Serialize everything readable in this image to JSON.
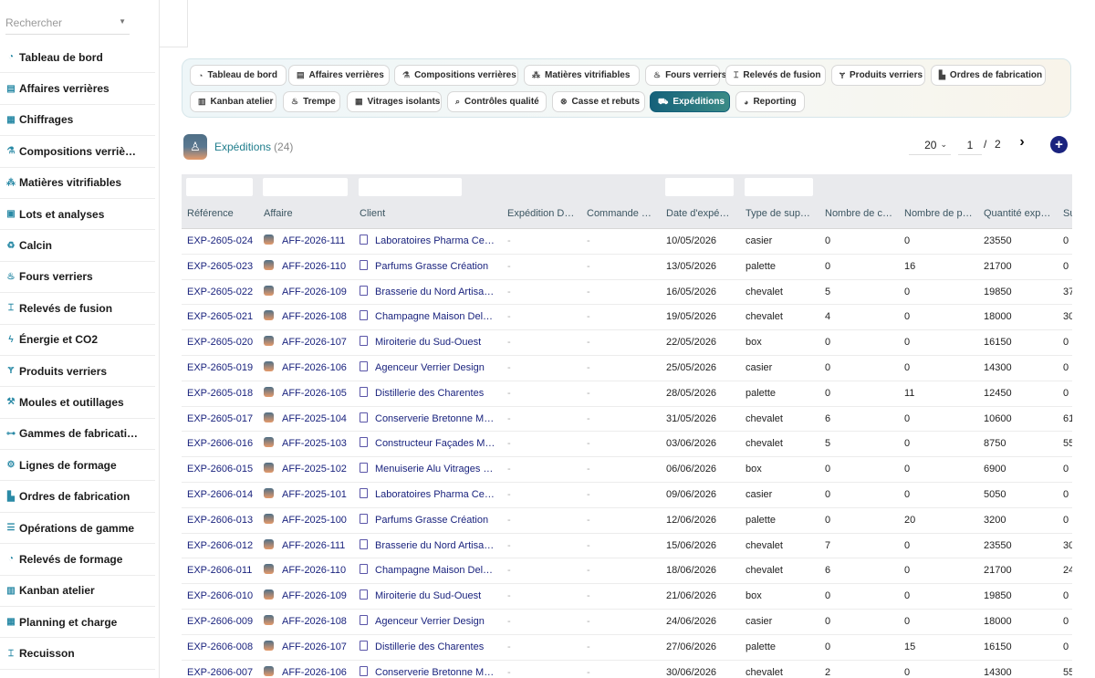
{
  "sidebar": {
    "search_placeholder": "Rechercher",
    "items": [
      {
        "label": "Tableau de bord",
        "icon": "gauge-icon",
        "glyph": "◔"
      },
      {
        "label": "Affaires verrières",
        "icon": "briefcase-icon",
        "glyph": "▤"
      },
      {
        "label": "Chiffrages",
        "icon": "calculator-icon",
        "glyph": "▦"
      },
      {
        "label": "Compositions verriè…",
        "icon": "flask-icon",
        "glyph": "⚗"
      },
      {
        "label": "Matières vitrifiables",
        "icon": "cubes-icon",
        "glyph": "⁂"
      },
      {
        "label": "Lots et analyses",
        "icon": "clipboard-check-icon",
        "glyph": "▣"
      },
      {
        "label": "Calcin",
        "icon": "recycle-icon",
        "glyph": "♻"
      },
      {
        "label": "Fours verriers",
        "icon": "fire-icon",
        "glyph": "♨"
      },
      {
        "label": "Relevés de fusion",
        "icon": "thermometer-icon",
        "glyph": "⌶"
      },
      {
        "label": "Énergie et CO2",
        "icon": "bolt-icon",
        "glyph": "ϟ"
      },
      {
        "label": "Produits verriers",
        "icon": "wine-glass-icon",
        "glyph": "Ɏ"
      },
      {
        "label": "Moules et outillages",
        "icon": "tools-icon",
        "glyph": "⚒"
      },
      {
        "label": "Gammes de fabricati…",
        "icon": "sitemap-icon",
        "glyph": "⊶"
      },
      {
        "label": "Lignes de formage",
        "icon": "cogs-icon",
        "glyph": "⚙"
      },
      {
        "label": "Ordres de fabrication",
        "icon": "industry-icon",
        "glyph": "▙"
      },
      {
        "label": "Opérations de gamme",
        "icon": "list-check-icon",
        "glyph": "☰"
      },
      {
        "label": "Relevés de formage",
        "icon": "gauge-icon",
        "glyph": "◔"
      },
      {
        "label": "Kanban atelier",
        "icon": "columns-icon",
        "glyph": "▥"
      },
      {
        "label": "Planning et charge",
        "icon": "calendar-icon",
        "glyph": "▦"
      },
      {
        "label": "Recuisson",
        "icon": "temperature-icon",
        "glyph": "⌶"
      }
    ]
  },
  "tabs": [
    {
      "label": "Tableau de bord",
      "icon": "gauge-icon",
      "glyph": "◔",
      "active": false
    },
    {
      "label": "Affaires verrières",
      "icon": "briefcase-icon",
      "glyph": "▤",
      "active": false
    },
    {
      "label": "Compositions verrières",
      "icon": "flask-icon",
      "glyph": "⚗",
      "active": false
    },
    {
      "label": "Matières vitrifiables",
      "icon": "cubes-icon",
      "glyph": "⁂",
      "active": false
    },
    {
      "label": "Fours verriers",
      "icon": "fire-icon",
      "glyph": "♨",
      "active": false
    },
    {
      "label": "Relevés de fusion",
      "icon": "thermometer-icon",
      "glyph": "⌶",
      "active": false
    },
    {
      "label": "Produits verriers",
      "icon": "wine-glass-icon",
      "glyph": "Ɏ",
      "active": false
    },
    {
      "label": "Ordres de fabrication",
      "icon": "industry-icon",
      "glyph": "▙",
      "active": false
    },
    {
      "label": "Kanban atelier",
      "icon": "columns-icon",
      "glyph": "▥",
      "active": false
    },
    {
      "label": "Trempe",
      "icon": "fire-icon",
      "glyph": "♨",
      "active": false
    },
    {
      "label": "Vitrages isolants",
      "icon": "grid-icon",
      "glyph": "▦",
      "active": false
    },
    {
      "label": "Contrôles qualité",
      "icon": "search-icon",
      "glyph": "⌕",
      "active": false
    },
    {
      "label": "Casse et rebuts",
      "icon": "times-circle-icon",
      "glyph": "⊗",
      "active": false
    },
    {
      "label": "Expéditions",
      "icon": "truck-icon",
      "glyph": "⛟",
      "active": true
    },
    {
      "label": "Reporting",
      "icon": "pie-chart-icon",
      "glyph": "◕",
      "active": false
    }
  ],
  "header": {
    "title": "Expéditions",
    "count": "(24)",
    "page_size": "20",
    "page_current": "1",
    "page_sep": "/",
    "page_total": "2"
  },
  "table": {
    "columns": [
      "Référence",
      "Affaire",
      "Client",
      "Expédition D…",
      "Commande …",
      "Date d'expé…",
      "Type de sup…",
      "Nombre de c…",
      "Nombre de p…",
      "Quantité exp…",
      "Su"
    ],
    "rows": [
      [
        "EXP-2605-024",
        "AFF-2026-111",
        "Laboratoires Pharma Ce…",
        "-",
        "-",
        "10/05/2026",
        "casier",
        "0",
        "0",
        "23550",
        "0"
      ],
      [
        "EXP-2605-023",
        "AFF-2026-110",
        "Parfums Grasse Création",
        "-",
        "-",
        "13/05/2026",
        "palette",
        "0",
        "16",
        "21700",
        "0"
      ],
      [
        "EXP-2605-022",
        "AFF-2026-109",
        "Brasserie du Nord Artisa…",
        "-",
        "-",
        "16/05/2026",
        "chevalet",
        "5",
        "0",
        "19850",
        "37"
      ],
      [
        "EXP-2605-021",
        "AFF-2026-108",
        "Champagne Maison Del…",
        "-",
        "-",
        "19/05/2026",
        "chevalet",
        "4",
        "0",
        "18000",
        "30"
      ],
      [
        "EXP-2605-020",
        "AFF-2026-107",
        "Miroiterie du Sud-Ouest",
        "-",
        "-",
        "22/05/2026",
        "box",
        "0",
        "0",
        "16150",
        "0"
      ],
      [
        "EXP-2605-019",
        "AFF-2026-106",
        "Agenceur Verrier Design",
        "-",
        "-",
        "25/05/2026",
        "casier",
        "0",
        "0",
        "14300",
        "0"
      ],
      [
        "EXP-2605-018",
        "AFF-2026-105",
        "Distillerie des Charentes",
        "-",
        "-",
        "28/05/2026",
        "palette",
        "0",
        "11",
        "12450",
        "0"
      ],
      [
        "EXP-2605-017",
        "AFF-2025-104",
        "Conserverie Bretonne M…",
        "-",
        "-",
        "31/05/2026",
        "chevalet",
        "6",
        "0",
        "10600",
        "61"
      ],
      [
        "EXP-2606-016",
        "AFF-2025-103",
        "Constructeur Façades M…",
        "-",
        "-",
        "03/06/2026",
        "chevalet",
        "5",
        "0",
        "8750",
        "55"
      ],
      [
        "EXP-2606-015",
        "AFF-2025-102",
        "Menuiserie Alu Vitrages …",
        "-",
        "-",
        "06/06/2026",
        "box",
        "0",
        "0",
        "6900",
        "0"
      ],
      [
        "EXP-2606-014",
        "AFF-2025-101",
        "Laboratoires Pharma Ce…",
        "-",
        "-",
        "09/06/2026",
        "casier",
        "0",
        "0",
        "5050",
        "0"
      ],
      [
        "EXP-2606-013",
        "AFF-2025-100",
        "Parfums Grasse Création",
        "-",
        "-",
        "12/06/2026",
        "palette",
        "0",
        "20",
        "3200",
        "0"
      ],
      [
        "EXP-2606-012",
        "AFF-2026-111",
        "Brasserie du Nord Artisa…",
        "-",
        "-",
        "15/06/2026",
        "chevalet",
        "7",
        "0",
        "23550",
        "30"
      ],
      [
        "EXP-2606-011",
        "AFF-2026-110",
        "Champagne Maison Del…",
        "-",
        "-",
        "18/06/2026",
        "chevalet",
        "6",
        "0",
        "21700",
        "24"
      ],
      [
        "EXP-2606-010",
        "AFF-2026-109",
        "Miroiterie du Sud-Ouest",
        "-",
        "-",
        "21/06/2026",
        "box",
        "0",
        "0",
        "19850",
        "0"
      ],
      [
        "EXP-2606-009",
        "AFF-2026-108",
        "Agenceur Verrier Design",
        "-",
        "-",
        "24/06/2026",
        "casier",
        "0",
        "0",
        "18000",
        "0"
      ],
      [
        "EXP-2606-008",
        "AFF-2026-107",
        "Distillerie des Charentes",
        "-",
        "-",
        "27/06/2026",
        "palette",
        "0",
        "15",
        "16150",
        "0"
      ],
      [
        "EXP-2606-007",
        "AFF-2026-106",
        "Conserverie Bretonne M…",
        "-",
        "-",
        "30/06/2026",
        "chevalet",
        "2",
        "0",
        "14300",
        "55"
      ]
    ]
  }
}
